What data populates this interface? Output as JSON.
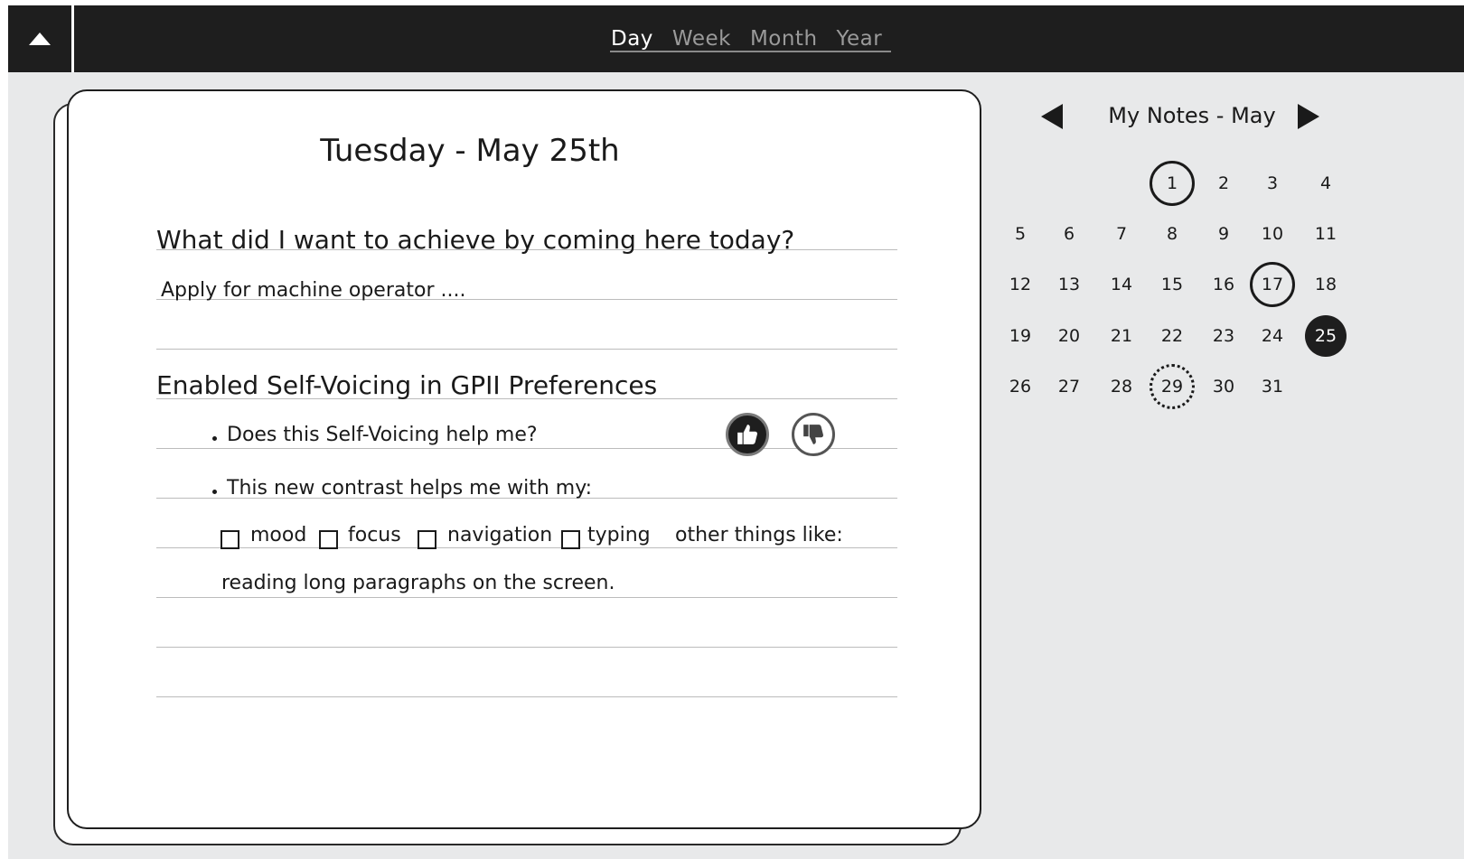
{
  "topbar": {
    "collapse_icon": "triangle-up-icon",
    "tabs": [
      {
        "label": "Day",
        "active": true
      },
      {
        "label": "Week",
        "active": false
      },
      {
        "label": "Month",
        "active": false
      },
      {
        "label": "Year",
        "active": false
      }
    ]
  },
  "notes": {
    "day_title": "Tuesday - May 25th",
    "question": "What did I want to achieve by coming here today?",
    "answer": "Apply for machine operator ....",
    "preference_heading": "Enabled Self-Voicing in GPII Preferences",
    "bullets": [
      "Does this Self-Voicing help me?",
      "This new contrast helps me with my:"
    ],
    "feedback": {
      "thumbs_up_icon": "thumbs-up-icon",
      "thumbs_down_icon": "thumbs-down-icon"
    },
    "checkboxes": [
      {
        "label": "mood",
        "checked": false
      },
      {
        "label": "focus",
        "checked": false
      },
      {
        "label": "navigation",
        "checked": false
      },
      {
        "label": "typing",
        "checked": false
      }
    ],
    "other_label": "other things like:",
    "other_text": "reading long paragraphs on the screen."
  },
  "calendar": {
    "title": "My Notes - May",
    "prev_icon": "triangle-left-icon",
    "next_icon": "triangle-right-icon",
    "weeks": [
      [
        "",
        "",
        "",
        "1",
        "2",
        "3",
        "4"
      ],
      [
        "5",
        "6",
        "7",
        "8",
        "9",
        "10",
        "11"
      ],
      [
        "12",
        "13",
        "14",
        "15",
        "16",
        "17",
        "18"
      ],
      [
        "19",
        "20",
        "21",
        "22",
        "23",
        "24",
        "25"
      ],
      [
        "26",
        "27",
        "28",
        "29",
        "30",
        "31",
        ""
      ]
    ],
    "outlined_days": [
      "1",
      "17"
    ],
    "selected_day": "25",
    "dashed_days": [
      "29"
    ]
  },
  "colors": {
    "topbar_bg": "#1e1e1e",
    "app_bg": "#e8e9ea",
    "active_tab": "#ffffff",
    "inactive_tab": "#9a9a9a",
    "selected_day_bg": "#1e1e1e"
  }
}
